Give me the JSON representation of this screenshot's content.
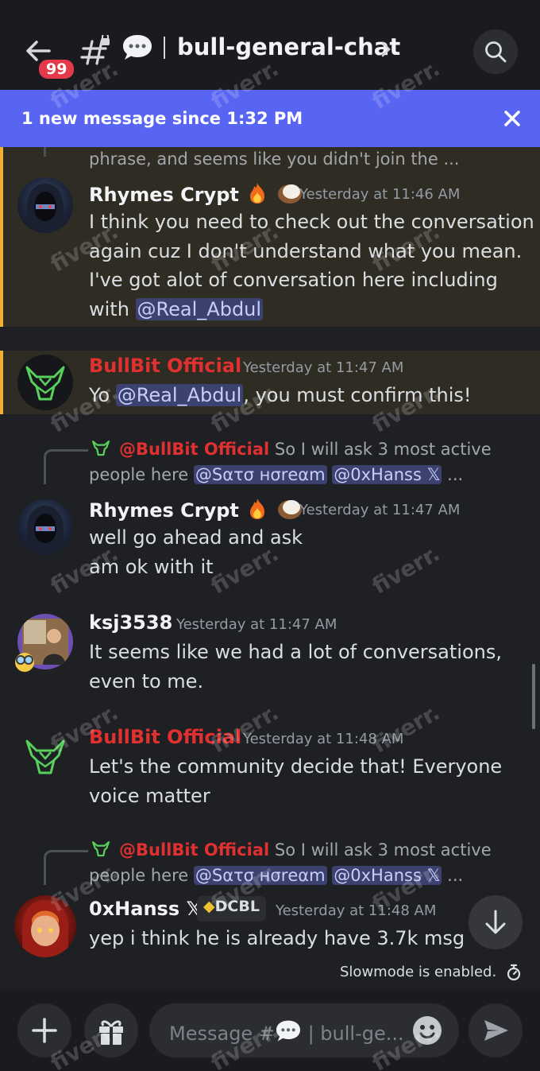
{
  "header": {
    "unread_badge": "99",
    "channel_name": "bull-general-chat"
  },
  "banner": {
    "text": "1 new message since 1:32 PM"
  },
  "messages": {
    "m0": {
      "truncated_line": "phrase, and seems like you didn't join the ..."
    },
    "m1": {
      "username": "Rhymes Crypt",
      "timestamp": "Yesterday at 11:46 AM",
      "lines": [
        "I think you need to check out the conversation",
        "again cuz I don't understand what you mean.",
        "I've got alot of conversation here including"
      ],
      "last_prefix": "with ",
      "mention": "@Real_Abdul"
    },
    "m2": {
      "username": "BullBit Official",
      "timestamp": "Yesterday at 11:47 AM",
      "prefix": "Yo ",
      "mention": "@Real_Abdul",
      "suffix": ", you must confirm this!"
    },
    "m3": {
      "reply_author": "@BullBit Official",
      "reply_text": "So I will ask 3 most active",
      "reply_line2_prefix": "people here ",
      "reply_mention1": "@Sατσ нσrеαm",
      "reply_mention2": "@0xHanss 𝕏",
      "reply_ellipsis": " ...",
      "username": "Rhymes Crypt",
      "timestamp": "Yesterday at 11:47 AM",
      "lines": [
        "well go ahead and ask",
        "am ok with it"
      ]
    },
    "m4": {
      "username": "ksj3538",
      "timestamp": "Yesterday at 11:47 AM",
      "lines": [
        "It seems like we had a lot of conversations,",
        "even to me."
      ]
    },
    "m5": {
      "username": "BullBit Official",
      "timestamp": "Yesterday at 11:48 AM",
      "lines": [
        "Let's the community decide that! Everyone",
        "voice matter"
      ]
    },
    "m6": {
      "reply_author": "@BullBit Official",
      "reply_text": "So I will ask 3 most active",
      "reply_line2_prefix": "people here ",
      "reply_mention1": "@Sατσ нσrеαm",
      "reply_mention2": "@0xHanss 𝕏",
      "reply_ellipsis": " ...",
      "username": "0xHanss 𝕏",
      "tag": "DCBL",
      "timestamp": "Yesterday at 11:48 AM",
      "lines": [
        "yep i think he is already have 3.7k msg"
      ]
    }
  },
  "slowmode": "Slowmode is enabled.",
  "composer": {
    "placeholder_prefix": "Message #",
    "placeholder_suffix": " | bull-ge..."
  },
  "watermark": "fiverr.",
  "colors": {
    "accent": "#5865f2",
    "highlight_bar": "#f0b232",
    "bullbit_name": "#e0302f",
    "badge": "#e3394a"
  }
}
